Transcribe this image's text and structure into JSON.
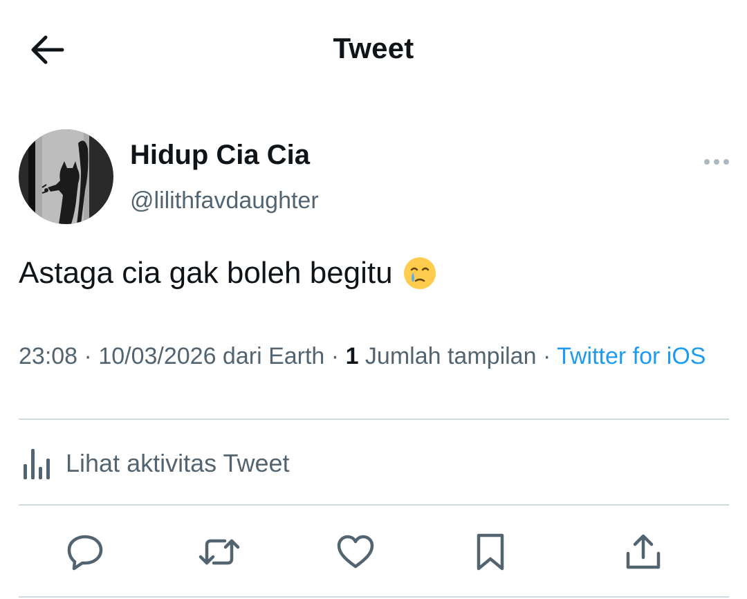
{
  "header": {
    "title": "Tweet",
    "back_icon": "arrow-left-icon"
  },
  "author": {
    "display_name": "Hidup Cia Cia",
    "handle": "@lilithfavdaughter",
    "avatar_icon": "avatar-image",
    "more_icon": "more-horizontal-icon"
  },
  "tweet": {
    "text": "Astaga cia gak boleh begitu",
    "emoji": "face-holding-back-tears"
  },
  "meta": {
    "time": "23:08",
    "sep1": " · ",
    "date": "10/03/2026",
    "location": " dari Earth",
    "sep2": " · ",
    "views_count": "1",
    "views_label": " Jumlah tampilan",
    "sep3": " · ",
    "source": "Twitter for iOS"
  },
  "activity": {
    "label": "Lihat aktivitas Tweet",
    "icon": "bar-chart-icon"
  },
  "actions": {
    "reply": "reply-icon",
    "retweet": "retweet-icon",
    "like": "heart-icon",
    "bookmark": "bookmark-icon",
    "share": "share-icon"
  },
  "colors": {
    "text": "#0f1419",
    "secondary": "#536471",
    "link": "#1d9bf0",
    "divider": "#cfd9de"
  }
}
